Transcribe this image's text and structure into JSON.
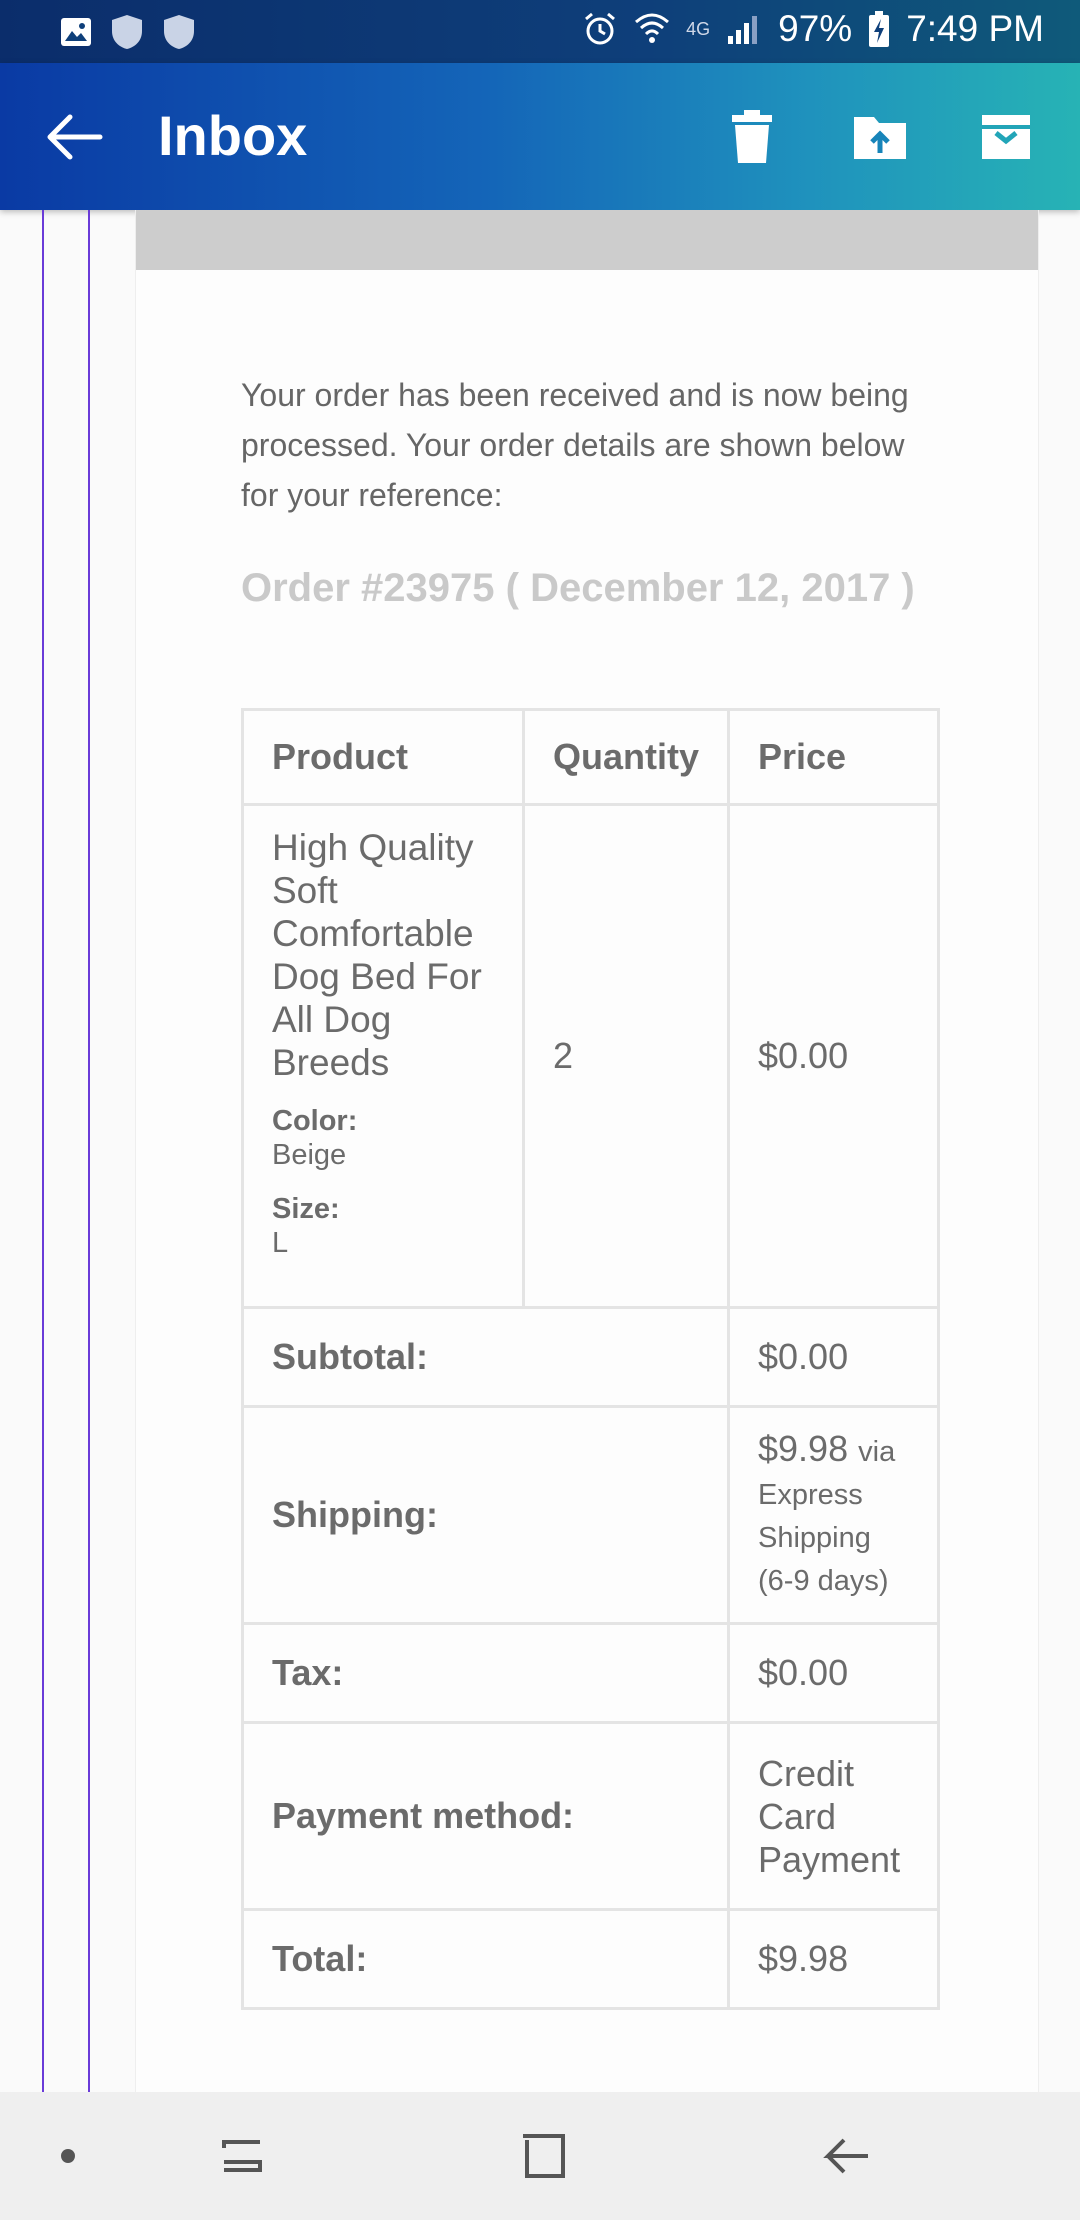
{
  "status_bar": {
    "battery": "97%",
    "time": "7:49 PM",
    "network": "4G",
    "icons": [
      "gallery-icon",
      "shield-icon",
      "shield-icon",
      "alarm-icon",
      "wifi-icon",
      "signal-icon",
      "battery-charging-icon"
    ]
  },
  "app_bar": {
    "title": "Inbox",
    "actions": [
      "delete-icon",
      "move-to-folder-icon",
      "archive-icon"
    ]
  },
  "email": {
    "intro": "Your order has been received and is now being processed. Your order details are shown below for your reference:",
    "order_heading": "Order #23975 ( December 12, 2017 )",
    "table": {
      "headers": {
        "product": "Product",
        "quantity": "Quantity",
        "price": "Price"
      },
      "item": {
        "name": "High Quality Soft Comfortable Dog Bed For All Dog Breeds",
        "color_label": "Color:",
        "color_value": "Beige",
        "size_label": "Size:",
        "size_value": "L",
        "quantity": "2",
        "price": "$0.00"
      },
      "totals": [
        {
          "label": "Subtotal:",
          "value": "$0.00"
        },
        {
          "label": "Shipping:",
          "value": "$9.98",
          "value_suffix": "via Express Shipping (6-9 days)"
        },
        {
          "label": "Tax:",
          "value": "$0.00"
        },
        {
          "label": "Payment method:",
          "value": "Credit Card Payment"
        },
        {
          "label": "Total:",
          "value": "$9.98"
        }
      ]
    }
  },
  "nav_bar": {
    "buttons": [
      "dot-icon",
      "recents-icon",
      "home-icon",
      "back-nav-icon"
    ]
  },
  "colors": {
    "app_bar_start": "#0a3aa4",
    "app_bar_end": "#27b3b5",
    "thread_line": "#6a3bd8"
  }
}
